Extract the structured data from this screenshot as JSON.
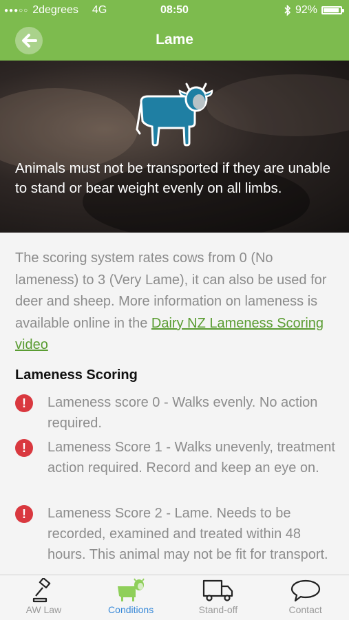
{
  "status": {
    "carrier": "2degrees",
    "network": "4G",
    "time": "08:50",
    "battery": "92%",
    "battery_level": 0.92
  },
  "nav": {
    "title": "Lame"
  },
  "hero": {
    "text": "Animals must not be transported if they are unable to stand or bear weight evenly on all limbs."
  },
  "intro": {
    "text": "The scoring system rates cows from 0 (No lameness) to 3 (Very Lame), it can also be used for deer and sheep. More information on lameness is available online in the ",
    "link": "Dairy NZ Lameness Scoring video"
  },
  "section": {
    "title": "Lameness Scoring"
  },
  "items": [
    {
      "text": "Lameness score 0 - Walks evenly. No action required."
    },
    {
      "text": "Lameness Score 1 - Walks unevenly, treatment action required. Record and keep an eye on."
    },
    {
      "text": "Lameness Score 2 - Lame. Needs to be recorded, examined and treated within 48 hours. This animal may not be fit for transport."
    }
  ],
  "alert_glyph": "!",
  "tabs": [
    {
      "label": "AW Law",
      "icon": "gavel-icon"
    },
    {
      "label": "Conditions",
      "icon": "cow-icon",
      "active": true
    },
    {
      "label": "Stand-off",
      "icon": "truck-icon"
    },
    {
      "label": "Contact",
      "icon": "speech-bubble-icon"
    }
  ],
  "colors": {
    "header_green": "#7dbb4e",
    "link_green": "#5a9c32",
    "alert_red": "#d9383f",
    "cow_teal": "#1f7fa3",
    "active_tab_blue": "#3a8ad8"
  }
}
